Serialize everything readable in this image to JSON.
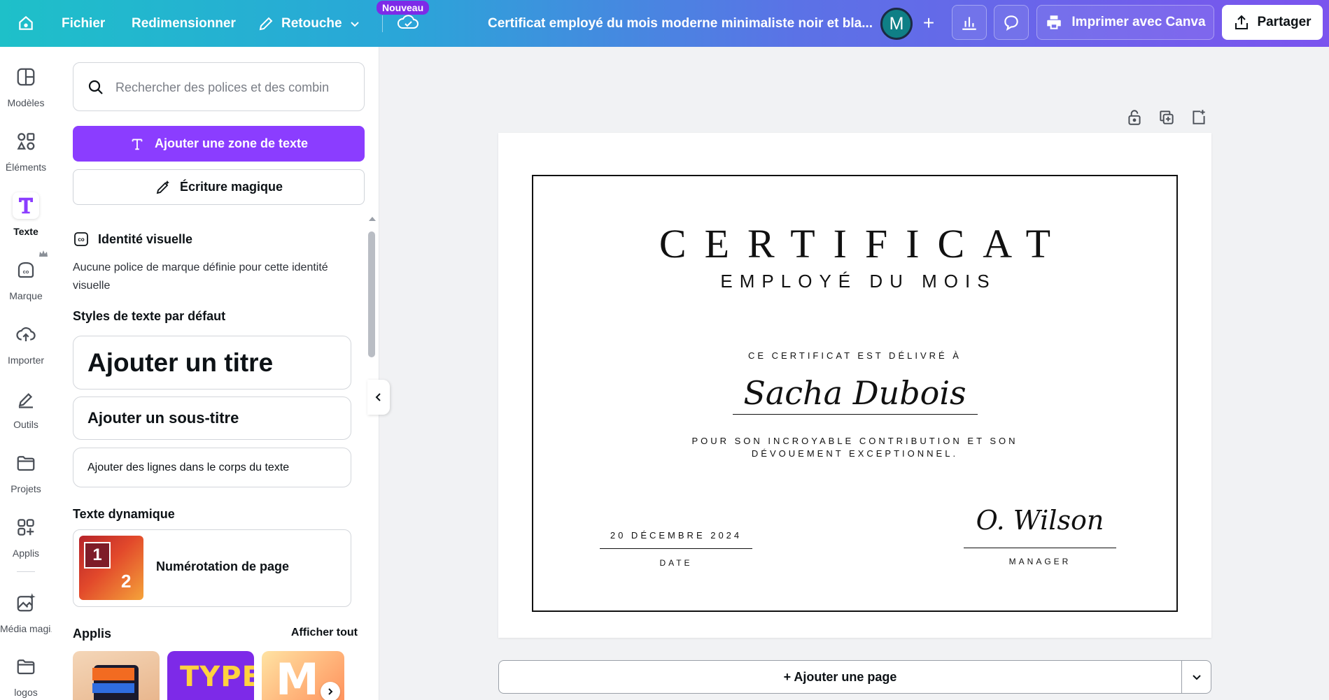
{
  "topbar": {
    "file": "Fichier",
    "resize": "Redimensionner",
    "edit": "Retouche",
    "new_badge": "Nouveau",
    "doc_title": "Certificat employé du mois moderne minimaliste noir et bla...",
    "avatar_letter": "M",
    "print": "Imprimer avec Canva",
    "share": "Partager"
  },
  "rail": {
    "items": [
      {
        "label": "Modèles",
        "icon": "templates-icon"
      },
      {
        "label": "Éléments",
        "icon": "elements-icon"
      },
      {
        "label": "Texte",
        "icon": "text-icon"
      },
      {
        "label": "Marque",
        "icon": "brand-icon"
      },
      {
        "label": "Importer",
        "icon": "upload-icon"
      },
      {
        "label": "Outils",
        "icon": "tools-icon"
      },
      {
        "label": "Projets",
        "icon": "projects-icon"
      },
      {
        "label": "Applis",
        "icon": "apps-icon"
      },
      {
        "label": "Média magi...",
        "icon": "magic-media-icon"
      },
      {
        "label": "logos",
        "icon": "folder-icon"
      }
    ]
  },
  "panel": {
    "search_placeholder": "Rechercher des polices et des combin",
    "add_textbox": "Ajouter une zone de texte",
    "magic_write": "Écriture magique",
    "brand_heading": "Identité visuelle",
    "brand_text": "Aucune police de marque définie pour cette identité visuelle",
    "default_styles": "Styles de texte par défaut",
    "add_title": "Ajouter un titre",
    "add_subtitle": "Ajouter un sous-titre",
    "add_body": "Ajouter des lignes dans le corps du texte",
    "dynamic_heading": "Texte dynamique",
    "page_numbering": "Numérotation de page",
    "thumb_numbers": [
      "1",
      "2"
    ],
    "apps_heading": "Applis",
    "see_all": "Afficher tout"
  },
  "certificate": {
    "title": "CERTIFICAT",
    "subtitle": "EMPLOYÉ DU MOIS",
    "issued_to": "CE CERTIFICAT EST DÉLIVRÉ À",
    "name": "Sacha Dubois",
    "reason_line1": "POUR SON INCROYABLE CONTRIBUTION ET SON",
    "reason_line2": "DÉVOUEMENT EXCEPTIONNEL.",
    "date": "20 DÉCEMBRE 2024",
    "date_label": "DATE",
    "signature": "O. Wilson",
    "signature_label": "MANAGER"
  },
  "canvas": {
    "add_page": "+ Ajouter une page"
  },
  "colors": {
    "accent": "#8b3dff",
    "topbar_start": "#1ec0c9",
    "topbar_end": "#7b54ee"
  }
}
